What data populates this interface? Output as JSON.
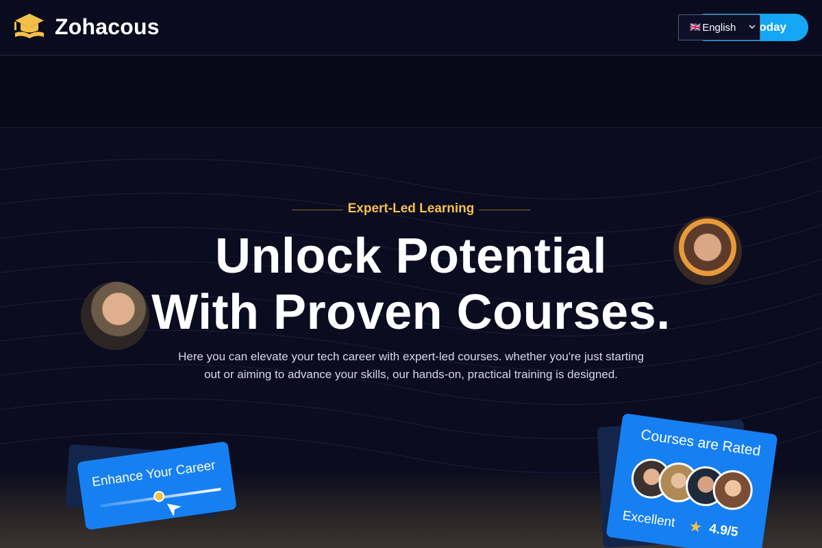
{
  "header": {
    "brand": "Zohacous",
    "cta_label": "oday",
    "language": {
      "flag": "🇬🇧",
      "selected": "English"
    }
  },
  "hero": {
    "eyebrow": "Expert-Led Learning",
    "headline_line1": "Unlock Potential",
    "headline_line2": "With Proven Courses.",
    "subtext": "Here you can elevate your tech career with expert-led courses. whether you're just starting out or aiming to advance your skills, our hands-on, practical training is designed."
  },
  "cards": {
    "career": {
      "title": "Enhance Your Career",
      "progress": 0.45
    },
    "rating": {
      "title": "Courses are Rated",
      "label": "Excellent",
      "score": "4.9/5"
    }
  },
  "colors": {
    "background": "#0a0b1f",
    "accent_blue": "#1680f2",
    "cta_blue": "#15a7f5",
    "gold": "#f5c04a"
  },
  "icons": [
    "graduation-cap-icon",
    "chevron-down-icon",
    "star-icon",
    "cursor-arrow-icon"
  ]
}
